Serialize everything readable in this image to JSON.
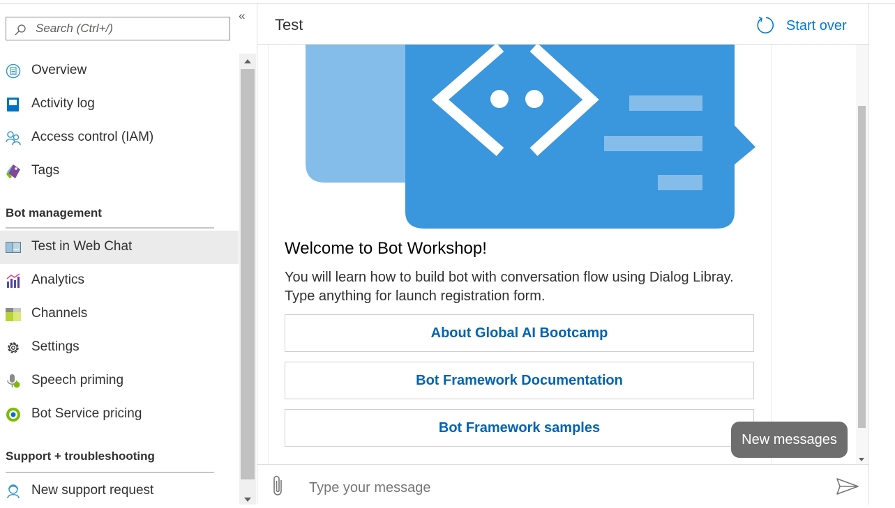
{
  "search": {
    "placeholder": "Search (Ctrl+/)"
  },
  "collapse_glyph": "«",
  "sidebar": {
    "items_top": [
      {
        "label": "Overview",
        "icon": "overview-icon"
      },
      {
        "label": "Activity log",
        "icon": "activity-log-icon"
      },
      {
        "label": "Access control (IAM)",
        "icon": "access-control-icon"
      },
      {
        "label": "Tags",
        "icon": "tag-icon"
      }
    ],
    "section_bot_management": "Bot management",
    "items_bot": [
      {
        "label": "Test in Web Chat",
        "icon": "web-chat-icon",
        "active": true
      },
      {
        "label": "Analytics",
        "icon": "analytics-icon"
      },
      {
        "label": "Channels",
        "icon": "channels-icon"
      },
      {
        "label": "Settings",
        "icon": "gear-icon"
      },
      {
        "label": "Speech priming",
        "icon": "microphone-icon"
      },
      {
        "label": "Bot Service pricing",
        "icon": "pricing-icon"
      }
    ],
    "section_support": "Support + troubleshooting",
    "items_support": [
      {
        "label": "New support request",
        "icon": "support-request-icon"
      }
    ]
  },
  "panel": {
    "title": "Test",
    "start_over_label": "Start over"
  },
  "card": {
    "title": "Welcome to Bot Workshop!",
    "text": "You will learn how to build bot with conversation flow using Dialog Libray. Type anything for launch registration form.",
    "actions": [
      "About Global AI Bootcamp",
      "Bot Framework Documentation",
      "Bot Framework samples"
    ]
  },
  "new_messages_label": "New messages",
  "composer": {
    "placeholder": "Type your message"
  },
  "colors": {
    "accent": "#0078d4",
    "action_text": "#0063b1",
    "hero_dark": "#3a96dd",
    "hero_light": "#85bdea"
  }
}
